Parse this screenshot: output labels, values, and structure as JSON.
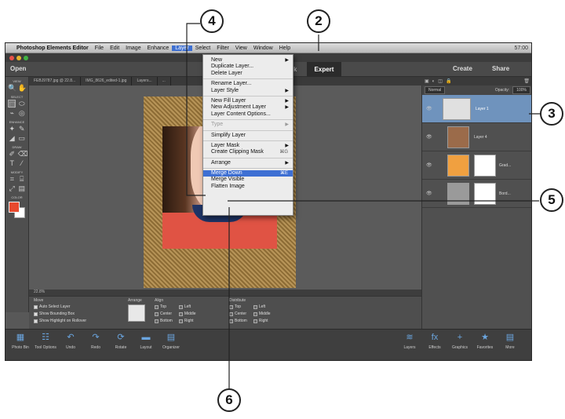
{
  "menubar": {
    "app": "Photoshop Elements Editor",
    "items": [
      "File",
      "Edit",
      "Image",
      "Enhance",
      "Layer",
      "Select",
      "Filter",
      "View",
      "Window",
      "Help"
    ],
    "active_item": "Layer",
    "status": "57:00"
  },
  "modebar": {
    "open_label": "Open",
    "quick_label": "Quick",
    "expert_label": "Expert",
    "create_label": "Create",
    "share_label": "Share"
  },
  "tabs": [
    "FEBJ9787.jpg @ 22.8...",
    "IMG_8626_edited-1.jpg",
    "Layers...",
    "..."
  ],
  "toolbox": {
    "sections": [
      "VIEW",
      "SELECT",
      "ENHANCE",
      "DRAW",
      "MODIFY",
      "COLOR"
    ],
    "foreground_color": "#e84a2e",
    "background_color": "#ffffff"
  },
  "statusbar": "22.8%",
  "tool_options": {
    "move_label": "Move",
    "move_options": [
      {
        "label": "Auto Select Layer",
        "checked": true
      },
      {
        "label": "Show Bounding Box",
        "checked": true
      },
      {
        "label": "Show Highlight on Rollover",
        "checked": true
      }
    ],
    "arrange_label": "Arrange",
    "align_label": "Align",
    "align_options": [
      "Top",
      "Left",
      "Center",
      "Middle",
      "Bottom",
      "Right"
    ],
    "distribute_label": "Distribute",
    "distribute_options": [
      "Top",
      "Left",
      "Center",
      "Middle",
      "Bottom",
      "Right"
    ]
  },
  "bottombar": {
    "left": [
      "Photo Bin",
      "Tool Options",
      "Undo",
      "Redo",
      "Rotate",
      "Layout",
      "Organizer"
    ],
    "right": [
      "Layers",
      "Effects",
      "Graphics",
      "Favorites",
      "More"
    ]
  },
  "layers_panel": {
    "blend_mode": "Normal",
    "opacity_label": "Opacity:",
    "opacity_value": "100%",
    "layers": [
      {
        "name": "Layer 1",
        "selected": true
      },
      {
        "name": "Layer 4",
        "selected": false
      },
      {
        "name": "Grad...",
        "selected": false
      },
      {
        "name": "Bord...",
        "selected": false
      }
    ]
  },
  "layer_menu": {
    "items": [
      {
        "label": "New",
        "submenu": true
      },
      {
        "label": "Duplicate Layer..."
      },
      {
        "label": "Delete Layer"
      },
      {
        "sep": true
      },
      {
        "label": "Rename Layer..."
      },
      {
        "label": "Layer Style",
        "submenu": true
      },
      {
        "sep": true
      },
      {
        "label": "New Fill Layer",
        "submenu": true
      },
      {
        "label": "New Adjustment Layer",
        "submenu": true
      },
      {
        "label": "Layer Content Options..."
      },
      {
        "sep": true
      },
      {
        "label": "Type",
        "submenu": true,
        "disabled": true
      },
      {
        "sep": true
      },
      {
        "label": "Simplify Layer"
      },
      {
        "sep": true
      },
      {
        "label": "Layer Mask",
        "submenu": true
      },
      {
        "label": "Create Clipping Mask",
        "shortcut": "⌘G"
      },
      {
        "sep": true
      },
      {
        "label": "Arrange",
        "submenu": true
      },
      {
        "sep": true
      },
      {
        "label": "Merge Down",
        "shortcut": "⌘E",
        "highlighted": true
      },
      {
        "label": "Merge Visible"
      },
      {
        "label": "Flatten Image"
      }
    ]
  },
  "callouts": [
    "2",
    "3",
    "4",
    "5",
    "6"
  ]
}
